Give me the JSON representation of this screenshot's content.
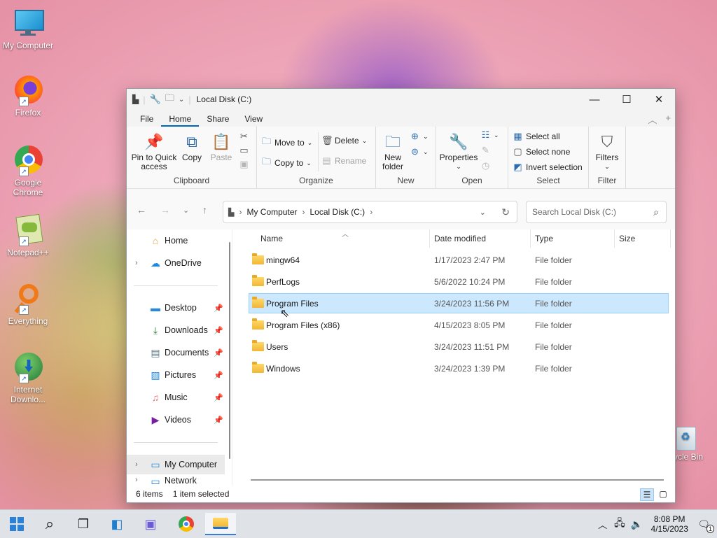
{
  "desktop": {
    "icons": [
      {
        "label": "My Computer",
        "icon": "monitor-icon"
      },
      {
        "label": "Firefox",
        "icon": "firefox-icon"
      },
      {
        "label": "Google Chrome",
        "icon": "chrome-icon"
      },
      {
        "label": "Notepad++",
        "icon": "notepadpp-icon"
      },
      {
        "label": "Everything",
        "icon": "everything-icon"
      },
      {
        "label": "Internet Downlo...",
        "icon": "idm-icon"
      }
    ],
    "recycle_bin": "ycle Bin"
  },
  "window": {
    "title": "Local Disk (C:)",
    "tabs": [
      "File",
      "Home",
      "Share",
      "View"
    ],
    "active_tab": "Home",
    "ribbon": {
      "clipboard": {
        "label": "Clipboard",
        "pin": "Pin to Quick access",
        "copy": "Copy",
        "paste": "Paste"
      },
      "organize": {
        "label": "Organize",
        "move_to": "Move to",
        "copy_to": "Copy to",
        "delete": "Delete",
        "rename": "Rename"
      },
      "new": {
        "label": "New",
        "new_folder": "New folder"
      },
      "open": {
        "label": "Open",
        "properties": "Properties"
      },
      "select": {
        "label": "Select",
        "select_all": "Select all",
        "select_none": "Select none",
        "invert": "Invert selection"
      },
      "filter": {
        "label": "Filter",
        "filters": "Filters"
      }
    },
    "address": {
      "crumbs": [
        "My Computer",
        "Local Disk (C:)"
      ]
    },
    "search": {
      "placeholder": "Search Local Disk (C:)"
    },
    "nav": {
      "home": "Home",
      "onedrive": "OneDrive",
      "quick": [
        {
          "label": "Desktop",
          "icon": "desktop-folder-icon",
          "color": "#2b88d8"
        },
        {
          "label": "Downloads",
          "icon": "download-icon",
          "color": "#2e7d32"
        },
        {
          "label": "Documents",
          "icon": "documents-icon",
          "color": "#607d8b"
        },
        {
          "label": "Pictures",
          "icon": "pictures-icon",
          "color": "#1e88e5"
        },
        {
          "label": "Music",
          "icon": "music-icon",
          "color": "#e57373"
        },
        {
          "label": "Videos",
          "icon": "videos-icon",
          "color": "#7b1fa2"
        }
      ],
      "my_computer": "My Computer",
      "network": "Network"
    },
    "columns": [
      "Name",
      "Date modified",
      "Type",
      "Size"
    ],
    "files": [
      {
        "name": "mingw64",
        "date": "1/17/2023 2:47 PM",
        "type": "File folder"
      },
      {
        "name": "PerfLogs",
        "date": "5/6/2022 10:24 PM",
        "type": "File folder"
      },
      {
        "name": "Program Files",
        "date": "3/24/2023 11:56 PM",
        "type": "File folder"
      },
      {
        "name": "Program Files (x86)",
        "date": "4/15/2023 8:05 PM",
        "type": "File folder"
      },
      {
        "name": "Users",
        "date": "3/24/2023 11:51 PM",
        "type": "File folder"
      },
      {
        "name": "Windows",
        "date": "3/24/2023 1:39 PM",
        "type": "File folder"
      }
    ],
    "selected_file": "Program Files",
    "status": {
      "count": "6 items",
      "selection": "1 item selected"
    }
  },
  "taskbar": {
    "time": "8:08 PM",
    "date": "4/15/2023",
    "notification_count": "1"
  }
}
